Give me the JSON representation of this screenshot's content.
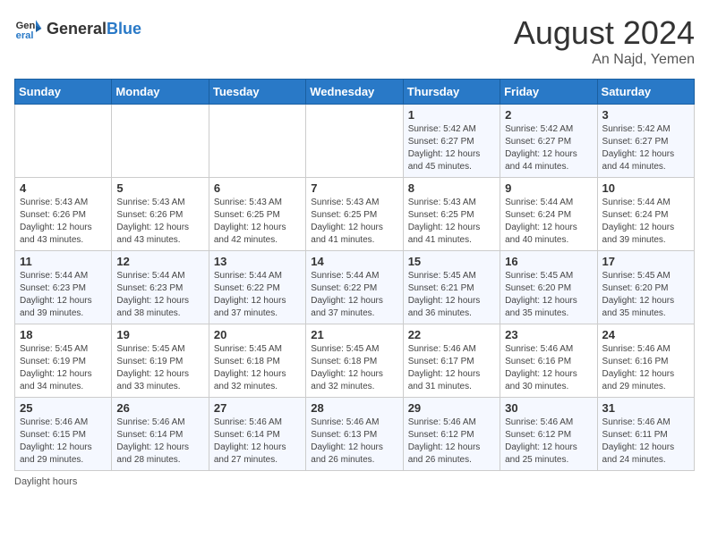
{
  "logo": {
    "general": "General",
    "blue": "Blue"
  },
  "title": {
    "month_year": "August 2024",
    "location": "An Najd, Yemen"
  },
  "days_of_week": [
    "Sunday",
    "Monday",
    "Tuesday",
    "Wednesday",
    "Thursday",
    "Friday",
    "Saturday"
  ],
  "footer": {
    "label": "Daylight hours"
  },
  "weeks": [
    [
      {
        "day": "",
        "info": ""
      },
      {
        "day": "",
        "info": ""
      },
      {
        "day": "",
        "info": ""
      },
      {
        "day": "",
        "info": ""
      },
      {
        "day": "1",
        "info": "Sunrise: 5:42 AM\nSunset: 6:27 PM\nDaylight: 12 hours\nand 45 minutes."
      },
      {
        "day": "2",
        "info": "Sunrise: 5:42 AM\nSunset: 6:27 PM\nDaylight: 12 hours\nand 44 minutes."
      },
      {
        "day": "3",
        "info": "Sunrise: 5:42 AM\nSunset: 6:27 PM\nDaylight: 12 hours\nand 44 minutes."
      }
    ],
    [
      {
        "day": "4",
        "info": "Sunrise: 5:43 AM\nSunset: 6:26 PM\nDaylight: 12 hours\nand 43 minutes."
      },
      {
        "day": "5",
        "info": "Sunrise: 5:43 AM\nSunset: 6:26 PM\nDaylight: 12 hours\nand 43 minutes."
      },
      {
        "day": "6",
        "info": "Sunrise: 5:43 AM\nSunset: 6:25 PM\nDaylight: 12 hours\nand 42 minutes."
      },
      {
        "day": "7",
        "info": "Sunrise: 5:43 AM\nSunset: 6:25 PM\nDaylight: 12 hours\nand 41 minutes."
      },
      {
        "day": "8",
        "info": "Sunrise: 5:43 AM\nSunset: 6:25 PM\nDaylight: 12 hours\nand 41 minutes."
      },
      {
        "day": "9",
        "info": "Sunrise: 5:44 AM\nSunset: 6:24 PM\nDaylight: 12 hours\nand 40 minutes."
      },
      {
        "day": "10",
        "info": "Sunrise: 5:44 AM\nSunset: 6:24 PM\nDaylight: 12 hours\nand 39 minutes."
      }
    ],
    [
      {
        "day": "11",
        "info": "Sunrise: 5:44 AM\nSunset: 6:23 PM\nDaylight: 12 hours\nand 39 minutes."
      },
      {
        "day": "12",
        "info": "Sunrise: 5:44 AM\nSunset: 6:23 PM\nDaylight: 12 hours\nand 38 minutes."
      },
      {
        "day": "13",
        "info": "Sunrise: 5:44 AM\nSunset: 6:22 PM\nDaylight: 12 hours\nand 37 minutes."
      },
      {
        "day": "14",
        "info": "Sunrise: 5:44 AM\nSunset: 6:22 PM\nDaylight: 12 hours\nand 37 minutes."
      },
      {
        "day": "15",
        "info": "Sunrise: 5:45 AM\nSunset: 6:21 PM\nDaylight: 12 hours\nand 36 minutes."
      },
      {
        "day": "16",
        "info": "Sunrise: 5:45 AM\nSunset: 6:20 PM\nDaylight: 12 hours\nand 35 minutes."
      },
      {
        "day": "17",
        "info": "Sunrise: 5:45 AM\nSunset: 6:20 PM\nDaylight: 12 hours\nand 35 minutes."
      }
    ],
    [
      {
        "day": "18",
        "info": "Sunrise: 5:45 AM\nSunset: 6:19 PM\nDaylight: 12 hours\nand 34 minutes."
      },
      {
        "day": "19",
        "info": "Sunrise: 5:45 AM\nSunset: 6:19 PM\nDaylight: 12 hours\nand 33 minutes."
      },
      {
        "day": "20",
        "info": "Sunrise: 5:45 AM\nSunset: 6:18 PM\nDaylight: 12 hours\nand 32 minutes."
      },
      {
        "day": "21",
        "info": "Sunrise: 5:45 AM\nSunset: 6:18 PM\nDaylight: 12 hours\nand 32 minutes."
      },
      {
        "day": "22",
        "info": "Sunrise: 5:46 AM\nSunset: 6:17 PM\nDaylight: 12 hours\nand 31 minutes."
      },
      {
        "day": "23",
        "info": "Sunrise: 5:46 AM\nSunset: 6:16 PM\nDaylight: 12 hours\nand 30 minutes."
      },
      {
        "day": "24",
        "info": "Sunrise: 5:46 AM\nSunset: 6:16 PM\nDaylight: 12 hours\nand 29 minutes."
      }
    ],
    [
      {
        "day": "25",
        "info": "Sunrise: 5:46 AM\nSunset: 6:15 PM\nDaylight: 12 hours\nand 29 minutes."
      },
      {
        "day": "26",
        "info": "Sunrise: 5:46 AM\nSunset: 6:14 PM\nDaylight: 12 hours\nand 28 minutes."
      },
      {
        "day": "27",
        "info": "Sunrise: 5:46 AM\nSunset: 6:14 PM\nDaylight: 12 hours\nand 27 minutes."
      },
      {
        "day": "28",
        "info": "Sunrise: 5:46 AM\nSunset: 6:13 PM\nDaylight: 12 hours\nand 26 minutes."
      },
      {
        "day": "29",
        "info": "Sunrise: 5:46 AM\nSunset: 6:12 PM\nDaylight: 12 hours\nand 26 minutes."
      },
      {
        "day": "30",
        "info": "Sunrise: 5:46 AM\nSunset: 6:12 PM\nDaylight: 12 hours\nand 25 minutes."
      },
      {
        "day": "31",
        "info": "Sunrise: 5:46 AM\nSunset: 6:11 PM\nDaylight: 12 hours\nand 24 minutes."
      }
    ]
  ]
}
